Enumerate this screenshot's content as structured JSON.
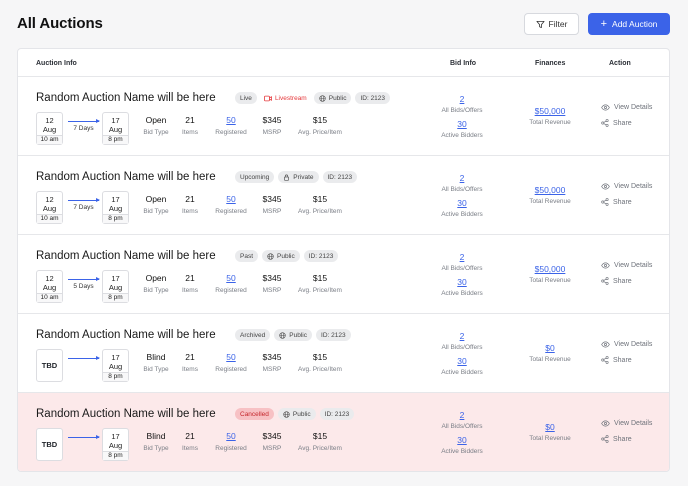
{
  "header": {
    "title": "All Auctions",
    "filter_label": "Filter",
    "add_label": "Add Auction"
  },
  "table": {
    "columns": {
      "info": "Auction Info",
      "bid": "Bid Info",
      "finances": "Finances",
      "action": "Action"
    }
  },
  "labels": {
    "bid_type": "Bid Type",
    "items": "Items",
    "registered": "Registered",
    "msrp": "MSRP",
    "avg_price": "Avg. Price/Item",
    "all_bids": "All Bids/Offers",
    "active_bidders": "Active Bidders",
    "total_revenue": "Total Revenue",
    "view_details": "View Details",
    "share": "Share"
  },
  "rows": [
    {
      "title": "Random Auction Name will be here",
      "status": "Live",
      "livestream": "Livestream",
      "visibility": "Public",
      "id": "ID: 2123",
      "start": {
        "day": "12",
        "month": "Aug",
        "time": "10 am"
      },
      "end": {
        "day": "17",
        "month": "Aug",
        "time": "8 pm"
      },
      "duration": "7 Days",
      "bid_type": "Open",
      "items": "21",
      "registered": "50",
      "msrp": "$345",
      "avg_price": "$15",
      "bids": "2",
      "active_bidders": "30",
      "revenue": "$50,000"
    },
    {
      "title": "Random Auction Name will be here",
      "status": "Upcoming",
      "visibility": "Private",
      "id": "ID: 2123",
      "start": {
        "day": "12",
        "month": "Aug",
        "time": "10 am"
      },
      "end": {
        "day": "17",
        "month": "Aug",
        "time": "8 pm"
      },
      "duration": "7 Days",
      "bid_type": "Open",
      "items": "21",
      "registered": "50",
      "msrp": "$345",
      "avg_price": "$15",
      "bids": "2",
      "active_bidders": "30",
      "revenue": "$50,000"
    },
    {
      "title": "Random Auction Name will be here",
      "status": "Past",
      "visibility": "Public",
      "id": "ID: 2123",
      "start": {
        "day": "12",
        "month": "Aug",
        "time": "10 am"
      },
      "end": {
        "day": "17",
        "month": "Aug",
        "time": "8 pm"
      },
      "duration": "5 Days",
      "bid_type": "Open",
      "items": "21",
      "registered": "50",
      "msrp": "$345",
      "avg_price": "$15",
      "bids": "2",
      "active_bidders": "30",
      "revenue": "$50,000"
    },
    {
      "title": "Random Auction Name will be here",
      "status": "Archived",
      "visibility": "Public",
      "id": "ID: 2123",
      "start_tbd": "TBD",
      "end": {
        "day": "17",
        "month": "Aug",
        "time": "8 pm"
      },
      "bid_type": "Blind",
      "items": "21",
      "registered": "50",
      "msrp": "$345",
      "avg_price": "$15",
      "bids": "2",
      "active_bidders": "30",
      "revenue": "$0"
    },
    {
      "title": "Random Auction Name will be here",
      "status": "Cancelled",
      "visibility": "Public",
      "id": "ID: 2123",
      "start_tbd": "TBD",
      "end": {
        "day": "17",
        "month": "Aug",
        "time": "8 pm"
      },
      "bid_type": "Blind",
      "items": "21",
      "registered": "50",
      "msrp": "$345",
      "avg_price": "$15",
      "bids": "2",
      "active_bidders": "30",
      "revenue": "$0"
    }
  ],
  "colors": {
    "accent": "#3b63e8",
    "livestream": "#e5383b",
    "cancelled_row_bg": "#fce9ea",
    "cancelled_badge": "#f7c1c4"
  }
}
